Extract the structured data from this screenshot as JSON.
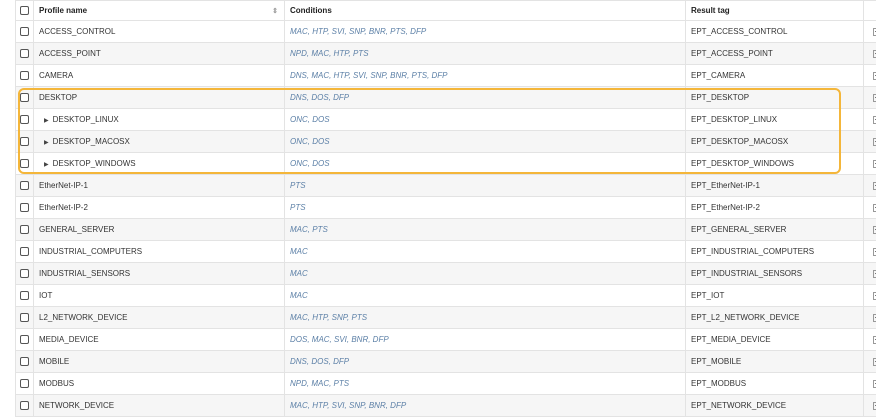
{
  "table": {
    "headers": {
      "profile_name": "Profile name",
      "conditions": "Conditions",
      "result_tag": "Result tag",
      "info": "i"
    },
    "highlight_color": "#f4b63a",
    "condition_color": "#5b7fa6",
    "rows": [
      {
        "name": "ACCESS_CONTROL",
        "conditions": "MAC, HTP, SVI, SNP, BNR, PTS, DFP",
        "result": "EPT_ACCESS_CONTROL"
      },
      {
        "name": "ACCESS_POINT",
        "conditions": "NPD, MAC, HTP, PTS",
        "result": "EPT_ACCESS_POINT"
      },
      {
        "name": "CAMERA",
        "conditions": "DNS, MAC, HTP, SVI, SNP, BNR, PTS, DFP",
        "result": "EPT_CAMERA"
      },
      {
        "name": "DESKTOP",
        "conditions": "DNS, DOS, DFP",
        "result": "EPT_DESKTOP"
      },
      {
        "name": "DESKTOP_LINUX",
        "conditions": "ONC, DOS",
        "result": "EPT_DESKTOP_LINUX"
      },
      {
        "name": "DESKTOP_MACOSX",
        "conditions": "ONC, DOS",
        "result": "EPT_DESKTOP_MACOSX"
      },
      {
        "name": "DESKTOP_WINDOWS",
        "conditions": "ONC, DOS",
        "result": "EPT_DESKTOP_WINDOWS"
      },
      {
        "name": "EtherNet-IP-1",
        "conditions": "PTS",
        "result": "EPT_EtherNet-IP-1"
      },
      {
        "name": "EtherNet-IP-2",
        "conditions": "PTS",
        "result": "EPT_EtherNet-IP-2"
      },
      {
        "name": "GENERAL_SERVER",
        "conditions": "MAC, PTS",
        "result": "EPT_GENERAL_SERVER"
      },
      {
        "name": "INDUSTRIAL_COMPUTERS",
        "conditions": "MAC",
        "result": "EPT_INDUSTRIAL_COMPUTERS"
      },
      {
        "name": "INDUSTRIAL_SENSORS",
        "conditions": "MAC",
        "result": "EPT_INDUSTRIAL_SENSORS"
      },
      {
        "name": "IOT",
        "conditions": "MAC",
        "result": "EPT_IOT"
      },
      {
        "name": "L2_NETWORK_DEVICE",
        "conditions": "MAC, HTP, SNP, PTS",
        "result": "EPT_L2_NETWORK_DEVICE"
      },
      {
        "name": "MEDIA_DEVICE",
        "conditions": "DOS, MAC, SVI, BNR, DFP",
        "result": "EPT_MEDIA_DEVICE"
      },
      {
        "name": "MOBILE",
        "conditions": "DNS, DOS, DFP",
        "result": "EPT_MOBILE"
      },
      {
        "name": "MODBUS",
        "conditions": "NPD, MAC, PTS",
        "result": "EPT_MODBUS"
      },
      {
        "name": "NETWORK_DEVICE",
        "conditions": "MAC, HTP, SVI, SNP, BNR, DFP",
        "result": "EPT_NETWORK_DEVICE"
      }
    ]
  }
}
